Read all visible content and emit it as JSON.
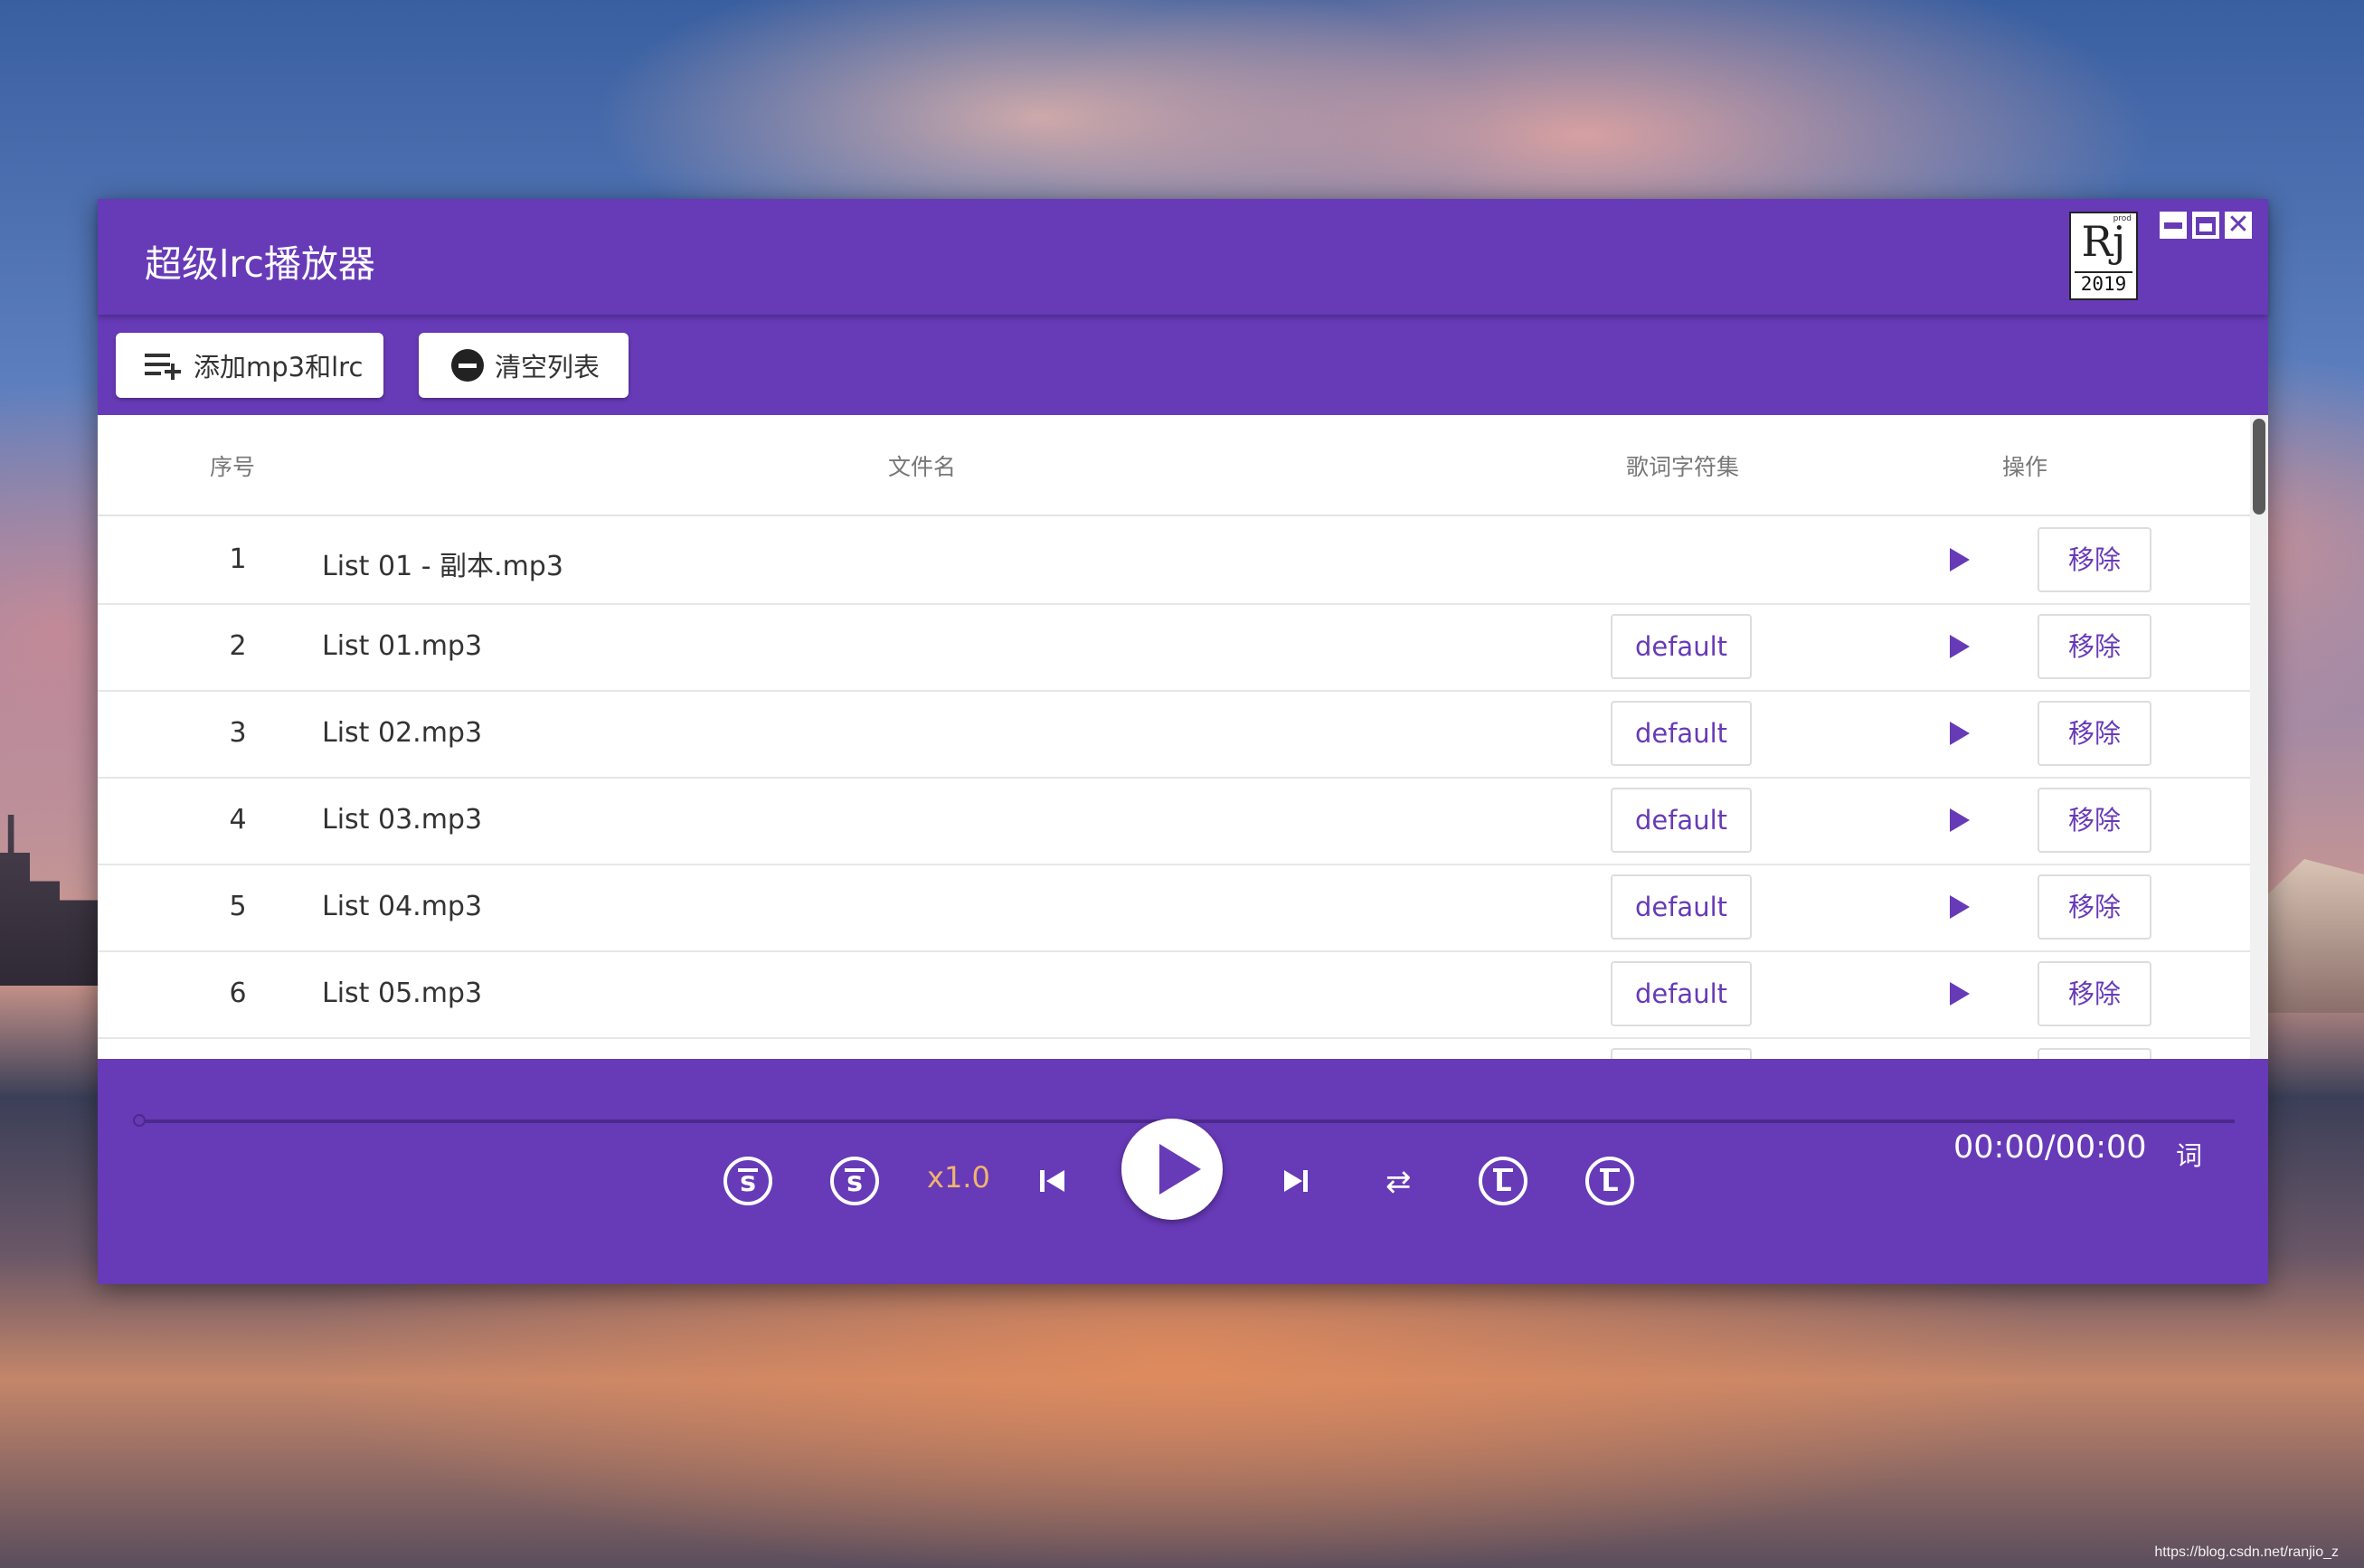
{
  "app": {
    "title": "超级lrc播放器",
    "logo": {
      "mark": "Rj",
      "tag": "prod",
      "year": "2019"
    },
    "window_controls": {
      "close_glyph": "✕"
    }
  },
  "toolbar": {
    "add_label": "添加mp3和lrc",
    "clear_label": "清空列表"
  },
  "table": {
    "headers": {
      "index": "序号",
      "filename": "文件名",
      "charset": "歌词字符集",
      "actions": "操作"
    },
    "rows": [
      {
        "index": "1",
        "name": "List 01 - 副本.mp3",
        "charset": "",
        "remove": "移除"
      },
      {
        "index": "2",
        "name": "List 01.mp3",
        "charset": "default",
        "remove": "移除"
      },
      {
        "index": "3",
        "name": "List 02.mp3",
        "charset": "default",
        "remove": "移除"
      },
      {
        "index": "4",
        "name": "List 03.mp3",
        "charset": "default",
        "remove": "移除"
      },
      {
        "index": "5",
        "name": "List 04.mp3",
        "charset": "default",
        "remove": "移除"
      },
      {
        "index": "6",
        "name": "List 05.mp3",
        "charset": "default",
        "remove": "移除"
      }
    ]
  },
  "player": {
    "speed": "x1.0",
    "time": "00:00/00:00",
    "lyric_label": "词",
    "progress": 0,
    "icons": [
      "rewind-s-icon",
      "forward-s-icon",
      "prev-icon",
      "play-icon",
      "next-icon",
      "repeat-icon",
      "lyric-back-icon",
      "lyric-forward-icon"
    ],
    "glyphs": {
      "s": "s",
      "l": "L",
      "repeat": "⇄"
    }
  },
  "watermark": "https://blog.csdn.net/ranjio_z",
  "colors": {
    "accent": "#673ab7",
    "speed": "#f0b56e"
  }
}
